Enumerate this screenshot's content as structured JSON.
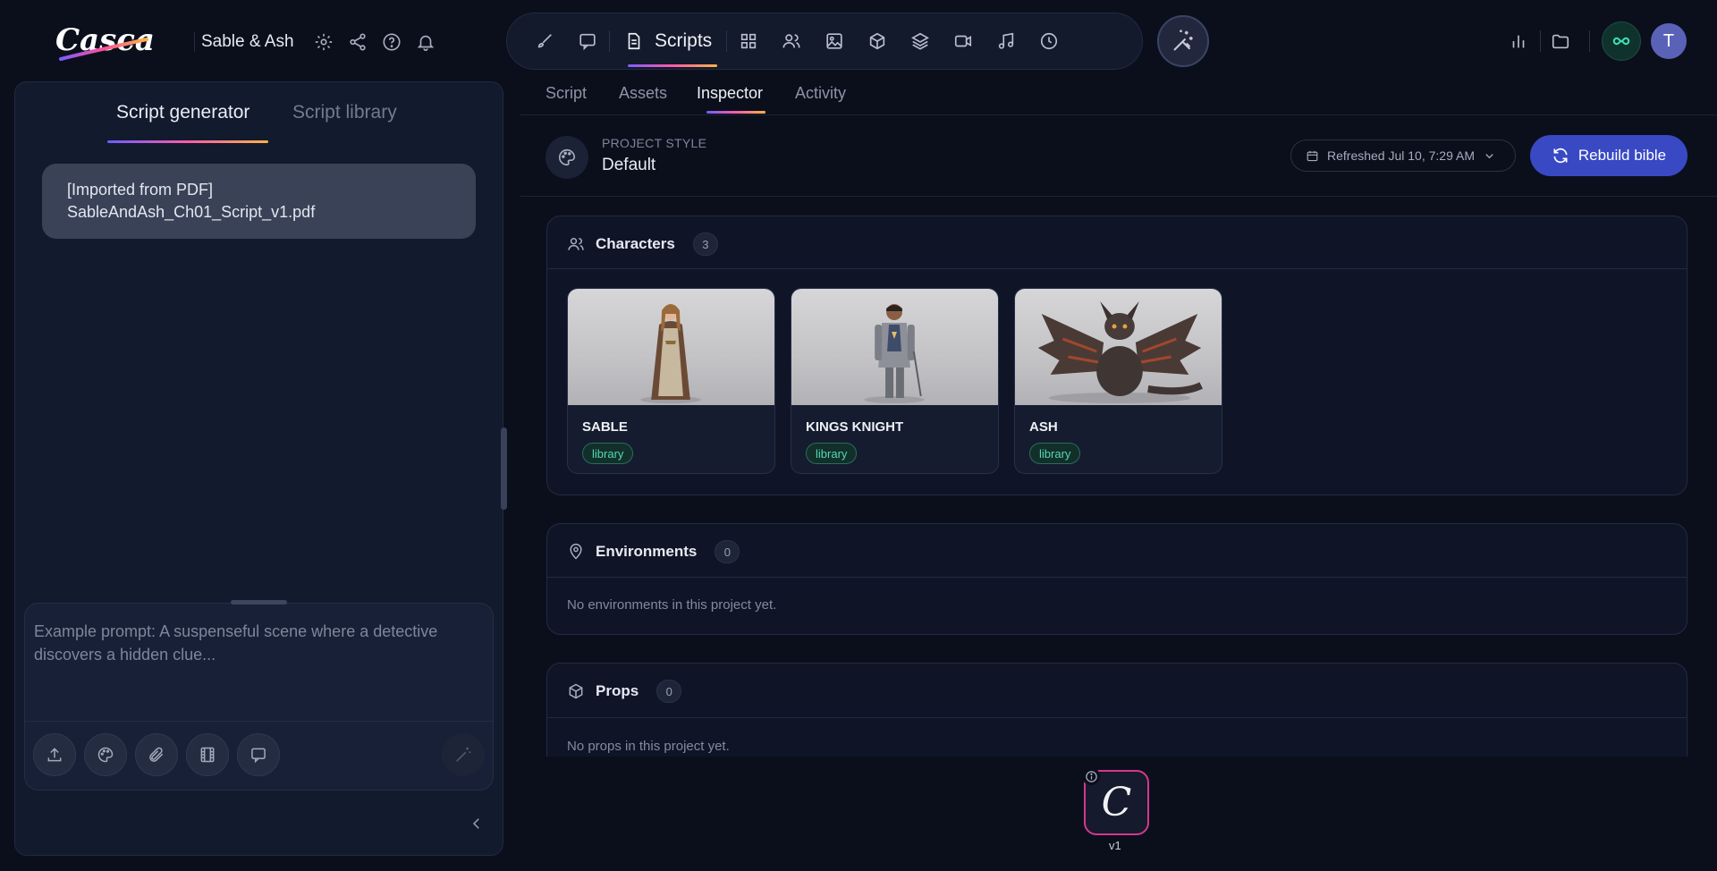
{
  "header": {
    "brand": "Cascade",
    "project_name": "Sable & Ash",
    "toolbar": {
      "active_label": "Scripts"
    },
    "user_initial": "T"
  },
  "left_panel": {
    "tabs": [
      "Script generator",
      "Script library"
    ],
    "active_tab": "Script generator",
    "message": {
      "line1": "[Imported from PDF]",
      "line2": "SableAndAsh_Ch01_Script_v1.pdf"
    },
    "composer": {
      "placeholder": "Example prompt: A suspenseful scene where a detective discovers a hidden clue..."
    }
  },
  "main": {
    "tabs": [
      "Script",
      "Assets",
      "Inspector",
      "Activity"
    ],
    "active_tab": "Inspector",
    "project_style": {
      "label": "PROJECT STYLE",
      "value": "Default"
    },
    "refreshed": "Refreshed Jul 10, 7:29 AM",
    "rebuild_label": "Rebuild bible",
    "characters": {
      "title": "Characters",
      "count": "3",
      "items": [
        {
          "name": "SABLE",
          "tag": "library"
        },
        {
          "name": "KINGS KNIGHT",
          "tag": "library"
        },
        {
          "name": "ASH",
          "tag": "library"
        }
      ]
    },
    "environments": {
      "title": "Environments",
      "count": "0",
      "empty": "No environments in this project yet."
    },
    "props": {
      "title": "Props",
      "count": "0",
      "empty": "No props in this project yet."
    },
    "version": {
      "glyph": "C",
      "label": "v1"
    }
  },
  "colors": {
    "accent": "#3949c4",
    "tag": "#55d6b3",
    "background": "#0b0f1c"
  }
}
